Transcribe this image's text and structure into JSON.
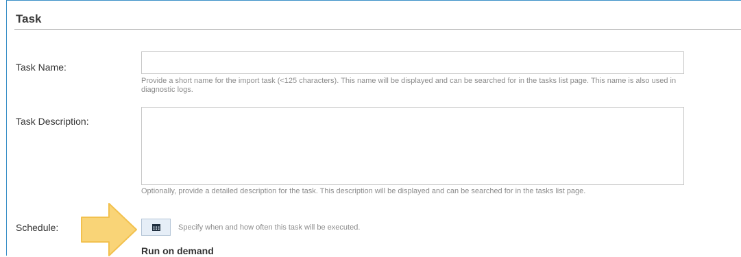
{
  "section": {
    "title": "Task"
  },
  "task_name": {
    "label": "Task Name:",
    "value": "",
    "help": "Provide a short name for the import task (<125 characters). This name will be displayed and can be searched for in the tasks list page. This name is also used in diagnostic logs."
  },
  "task_description": {
    "label": "Task Description:",
    "value": "",
    "help": "Optionally, provide a detailed description for the task. This description will be displayed and can be searched for in the tasks list page."
  },
  "schedule": {
    "label": "Schedule:",
    "button_icon": "calendar-icon",
    "help": "Specify when and how often this task will be executed.",
    "current": "Run on demand"
  },
  "colors": {
    "accent_border": "#3a8fc7",
    "callout_arrow": "#f7cd63"
  }
}
